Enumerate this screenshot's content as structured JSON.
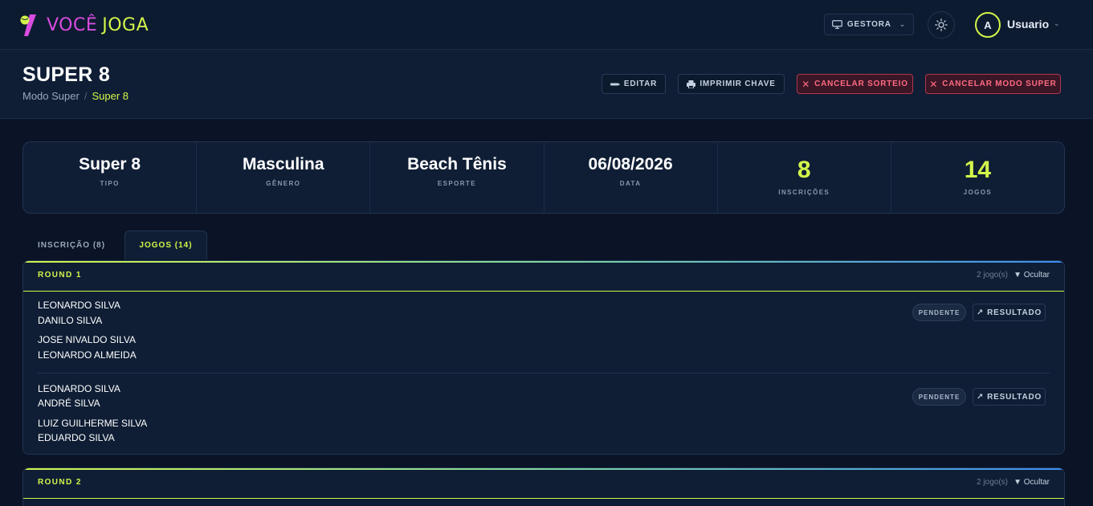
{
  "header": {
    "logo_voce": "VOCÊ",
    "logo_joga": "JOGA",
    "role_label": "GESTORA",
    "avatar_initial": "A",
    "user_name": "Usuario"
  },
  "page": {
    "title": "SUPER 8",
    "breadcrumb": {
      "parent": "Modo Super",
      "separator": "/",
      "current": "Super 8"
    },
    "actions": {
      "edit": "EDITAR",
      "print": "IMPRIMIR CHAVE",
      "cancel_draw": "CANCELAR SORTEIO",
      "cancel_super": "CANCELAR MODO SUPER"
    }
  },
  "stats": {
    "tipo": {
      "value": "Super 8",
      "label": "TIPO"
    },
    "genero": {
      "value": "Masculina",
      "label": "GÊNERO"
    },
    "esporte": {
      "value": "Beach Tênis",
      "label": "ESPORTE"
    },
    "data": {
      "value": "06/08/2026",
      "label": "DATA"
    },
    "inscricoes": {
      "value": "8",
      "label": "INSCRIÇÕES"
    },
    "jogos": {
      "value": "14",
      "label": "JOGOS"
    }
  },
  "tabs": {
    "inscricao": "INSCRIÇÃO (8)",
    "jogos": "JOGOS (14)"
  },
  "rounds": [
    {
      "title": "ROUND 1",
      "count": "2 jogo(s)",
      "toggle": "▼ Ocultar",
      "matches": [
        {
          "team1": [
            "LEONARDO SILVA",
            "DANILO SILVA"
          ],
          "team2": [
            "JOSE NIVALDO SILVA",
            "LEONARDO ALMEIDA"
          ],
          "status": "PENDENTE",
          "result_label": "RESULTADO"
        },
        {
          "team1": [
            "LEONARDO SILVA",
            "ANDRÉ SILVA"
          ],
          "team2": [
            "LUIZ GUILHERME SILVA",
            "EDUARDO SILVA"
          ],
          "status": "PENDENTE",
          "result_label": "RESULTADO"
        }
      ]
    },
    {
      "title": "ROUND 2",
      "count": "2 jogo(s)",
      "toggle": "▼ Ocultar"
    }
  ],
  "icons": {
    "monitor": "monitor-icon",
    "sun": "sun-icon",
    "pencil": "pencil-icon",
    "printer": "printer-icon",
    "close": "close-icon",
    "arrow": "arrow-up-right-icon"
  },
  "colors": {
    "accent": "#d3f54a",
    "logo_magenta": "#d84ce0",
    "danger": "#ff6b80",
    "background": "#0a1426",
    "surface": "#0f1e35"
  }
}
